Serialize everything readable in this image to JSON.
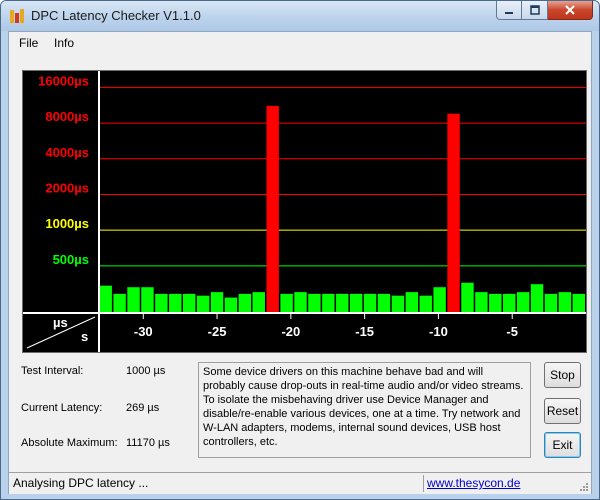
{
  "window": {
    "title": "DPC Latency Checker V1.1.0"
  },
  "menu": [
    "File",
    "Info"
  ],
  "chart_data": {
    "type": "bar",
    "y_scale": "log",
    "y_unit_label": "µs",
    "x_unit_label": "s",
    "y_ticks": [
      {
        "label": "16000µs",
        "value": 16000,
        "color": "#ff0000"
      },
      {
        "label": "8000µs",
        "value": 8000,
        "color": "#ff0000"
      },
      {
        "label": "4000µs",
        "value": 4000,
        "color": "#ff0000"
      },
      {
        "label": "2000µs",
        "value": 2000,
        "color": "#ff0000"
      },
      {
        "label": "1000µs",
        "value": 1000,
        "color": "#ffff00"
      },
      {
        "label": "500µs",
        "value": 500,
        "color": "#00ff00"
      }
    ],
    "x_ticks": [
      -30,
      -25,
      -20,
      -15,
      -10,
      -5
    ],
    "x_range": [
      -33,
      0
    ],
    "y_range": [
      200,
      22000
    ],
    "bar_values": [
      340,
      290,
      330,
      330,
      290,
      290,
      290,
      280,
      300,
      270,
      290,
      300,
      11170,
      290,
      300,
      290,
      290,
      290,
      290,
      290,
      290,
      280,
      300,
      280,
      330,
      9600,
      360,
      300,
      290,
      290,
      300,
      350,
      290,
      300,
      290
    ]
  },
  "info": [
    {
      "label": "Test Interval:",
      "value": "1000 µs"
    },
    {
      "label": "Current Latency:",
      "value": "269 µs"
    },
    {
      "label": "Absolute Maximum:",
      "value": "11170 µs"
    }
  ],
  "message": "Some device drivers on this machine behave bad and will probably cause drop-outs in real-time audio and/or video streams. To isolate the misbehaving driver use Device Manager and disable/re-enable various devices, one at a time. Try network and W-LAN adapters, modems, internal sound devices, USB host controllers, etc.",
  "buttons": {
    "stop": "Stop",
    "reset": "Reset",
    "exit": "Exit"
  },
  "status": {
    "text": "Analysing DPC latency ...",
    "link": "www.thesycon.de"
  }
}
